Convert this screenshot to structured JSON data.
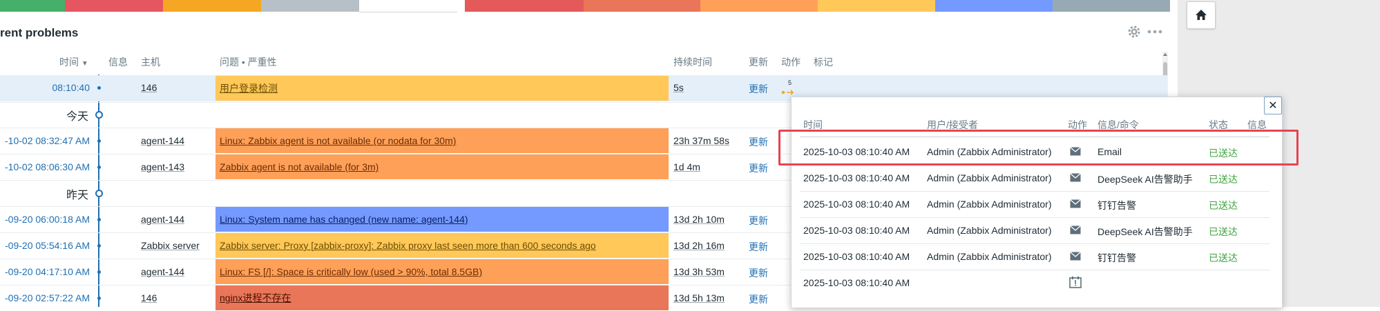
{
  "colors": {
    "strip": [
      "#44b06a",
      "#e65660",
      "#f5a623",
      "#b7c0c6",
      "#ffffff",
      "#e45959",
      "#e97659",
      "#ffa059",
      "#ffc859",
      "#7499ff",
      "#97aab3"
    ],
    "sev_average": "#ffa059",
    "sev_warning": "#ffc859",
    "sev_info": "#7499ff",
    "sev_high": "#e97659",
    "accent": "#1f6fb3",
    "sent": "#3ea33e",
    "highlight": "#e8434f"
  },
  "widget": {
    "title": "rent problems",
    "headers": {
      "time": "时间",
      "info": "信息",
      "host": "主机",
      "problem": "问题 • 严重性",
      "duration": "持续时间",
      "update": "更新",
      "actions": "动作",
      "tags": "标记"
    },
    "first_row": {
      "time": "08:10:40",
      "host": "146",
      "problem": "用户登录检测",
      "duration": "5s",
      "update": "更新",
      "action_count": "5"
    },
    "day_today": "今天",
    "today_rows": [
      {
        "time": "-10-02 08:32:47 AM",
        "host": "agent-144",
        "problem": "Linux: Zabbix agent is not available (or nodata for 30m)",
        "duration": "23h 37m 58s",
        "update": "更新"
      },
      {
        "time": "-10-02 08:06:30 AM",
        "host": "agent-143",
        "problem": "Zabbix agent is not available (for 3m)",
        "duration": "1d 4m",
        "update": "更新"
      }
    ],
    "day_yesterday": "昨天",
    "yesterday_rows": [
      {
        "time": "-09-20 06:00:18 AM",
        "host": "agent-144",
        "problem": "Linux: System name has changed (new name: agent-144)",
        "duration": "13d 2h 10m",
        "update": "更新"
      },
      {
        "time": "-09-20 05:54:16 AM",
        "host": "Zabbix server",
        "problem": "Zabbix server: Proxy [zabbix-proxy]: Zabbix proxy last seen more than 600 seconds ago",
        "duration": "13d 2h 16m",
        "update": "更新"
      },
      {
        "time": "-09-20 04:17:10 AM",
        "host": "agent-144",
        "problem": "Linux: FS [/]: Space is critically low (used > 90%, total 8.5GB)",
        "duration": "13d 3h 53m",
        "update": "更新"
      },
      {
        "time": "-09-20 02:57:22 AM",
        "host": "146",
        "problem": "nginx进程不存在",
        "duration": "13d 5h 13m",
        "update": "更新"
      }
    ]
  },
  "popup": {
    "headers": {
      "time": "时间",
      "user": "用户/接受者",
      "action": "动作",
      "message": "信息/命令",
      "status": "状态",
      "info": "信息"
    },
    "rows": [
      {
        "time": "2025-10-03 08:10:40 AM",
        "user": "Admin (Zabbix Administrator)",
        "icon": "mail-icon",
        "message": "Email",
        "status": "已送达"
      },
      {
        "time": "2025-10-03 08:10:40 AM",
        "user": "Admin (Zabbix Administrator)",
        "icon": "mail-icon",
        "message": "DeepSeek AI告警助手",
        "status": "已送达"
      },
      {
        "time": "2025-10-03 08:10:40 AM",
        "user": "Admin (Zabbix Administrator)",
        "icon": "mail-icon",
        "message": "钉钉告警",
        "status": "已送达"
      },
      {
        "time": "2025-10-03 08:10:40 AM",
        "user": "Admin (Zabbix Administrator)",
        "icon": "mail-icon",
        "message": "DeepSeek AI告警助手",
        "status": "已送达"
      },
      {
        "time": "2025-10-03 08:10:40 AM",
        "user": "Admin (Zabbix Administrator)",
        "icon": "mail-icon",
        "message": "钉钉告警",
        "status": "已送达"
      },
      {
        "time": "2025-10-03 08:10:40 AM",
        "user": "",
        "icon": "calendar-alert-icon",
        "message": "",
        "status": ""
      }
    ]
  }
}
